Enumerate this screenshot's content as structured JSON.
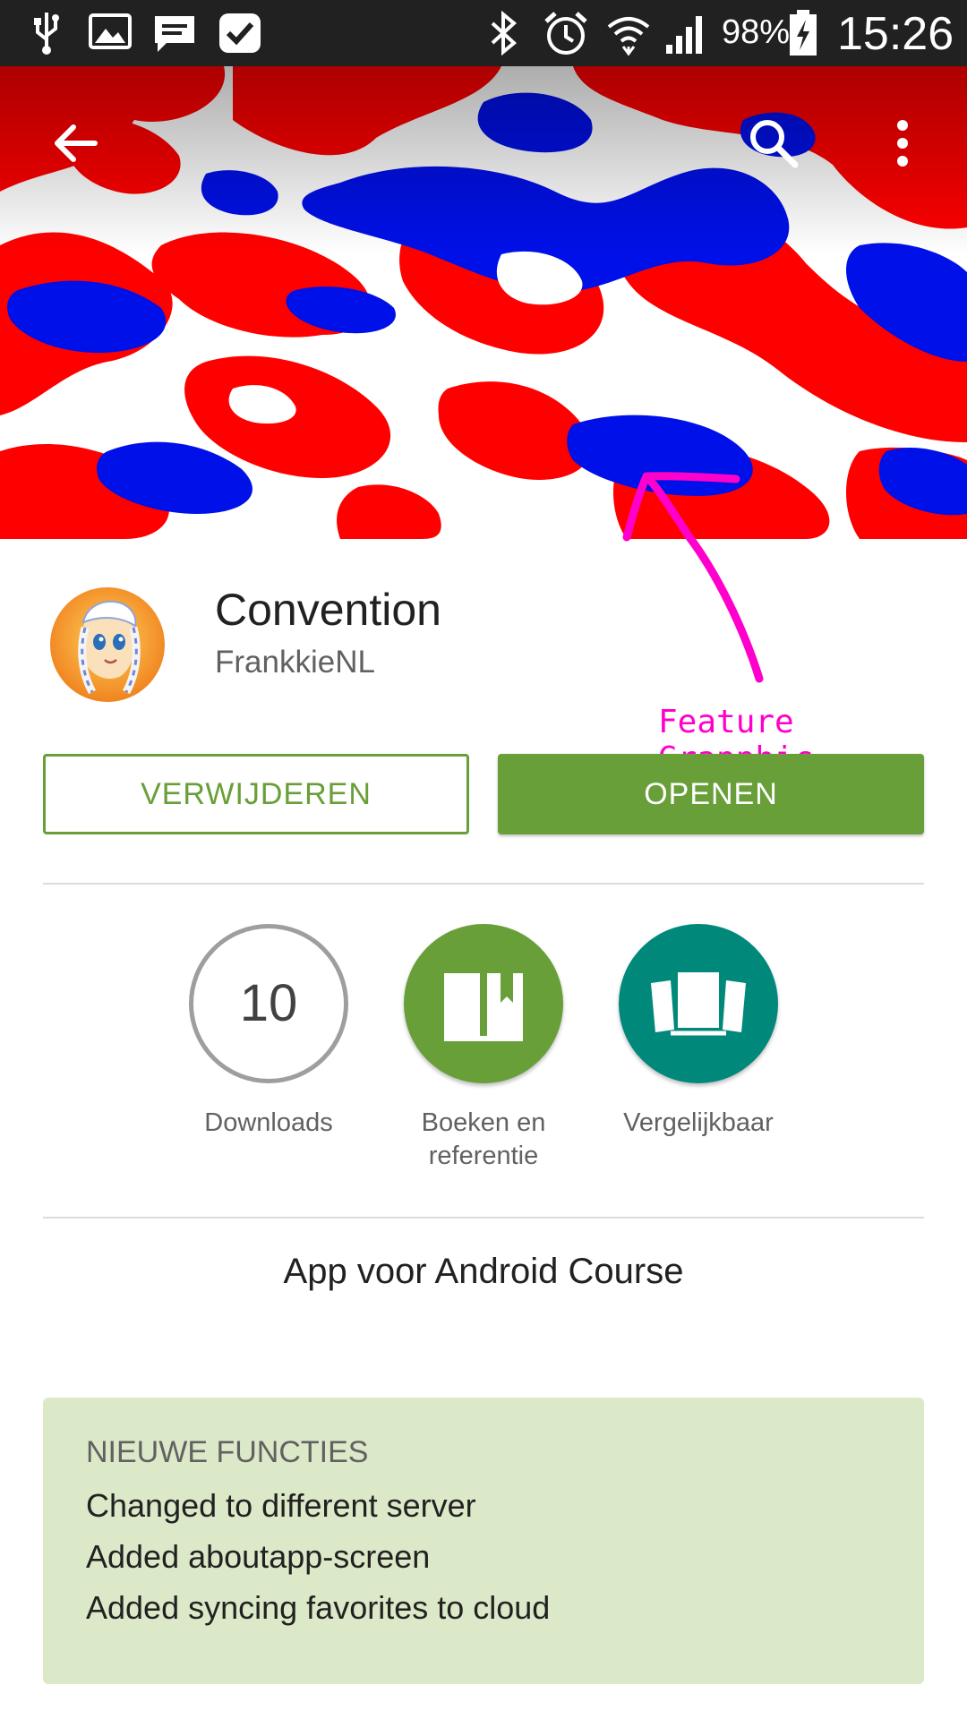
{
  "status_bar": {
    "battery_percent": "98%",
    "time": "15:26",
    "left_icons": [
      "usb-icon",
      "image-icon",
      "message-icon",
      "task-check-icon"
    ],
    "right_icons": [
      "bluetooth-icon",
      "alarm-icon",
      "wifi-icon",
      "signal-icon",
      "battery-charging-icon"
    ]
  },
  "toolbar": {
    "back_icon": "back-arrow-icon",
    "search_icon": "search-icon",
    "menu_icon": "more-vert-icon"
  },
  "annotation": {
    "label": "Feature Grapphic",
    "color": "#ff00cc"
  },
  "app": {
    "title": "Convention",
    "developer": "FrankkieNL"
  },
  "buttons": {
    "uninstall": "VERWIJDEREN",
    "open": "OPENEN"
  },
  "badges": {
    "downloads_value": "10",
    "downloads_label": "Downloads",
    "category_label": "Boeken en referentie",
    "similar_label": "Vergelijkbaar"
  },
  "description": "App voor Android Course",
  "whats_new": {
    "heading": "NIEUWE FUNCTIES",
    "items": [
      "Changed to different server",
      "Added aboutapp-screen",
      "Added syncing favorites to cloud"
    ]
  },
  "colors": {
    "accent_green": "#689f38",
    "teal": "#00897b",
    "whats_new_bg": "#dce9c8",
    "camo_red": "#ff0000",
    "camo_blue": "#0010e8"
  }
}
